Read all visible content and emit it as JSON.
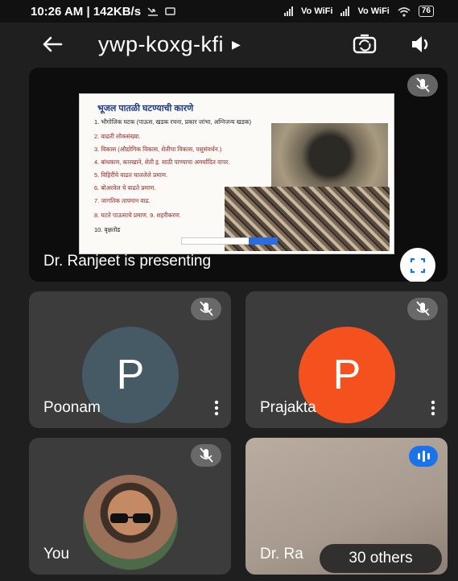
{
  "status_bar": {
    "time_speed": "10:26 AM | 142KB/s",
    "net1": "Vo WiFi",
    "net2": "Vo WiFi",
    "battery": "76"
  },
  "meeting": {
    "code": "ywp-koxg-kfi"
  },
  "presentation": {
    "caption": "Dr. Ranjeet is presenting",
    "slide_title": "भूजल पातळी घटण्याची कारणे",
    "slide_lines": [
      "1. भौगोलिक घटक (पाऊस, खडक रचना, प्रकार जांभा, अग्निजन्य खडक)",
      "2. वाढती लोकसंख्या.",
      "3. विकास (औद्योगिक विकास, शेतीचा विकास, पशुसंवर्धन.)",
      "4. बांधकाम, कारखाने, शेती इ. साठी पाण्याचा अमर्यादित वापर.",
      "5. विहिरींचे वाढत चाललेले प्रमाण.",
      "6. बोअरवेल चे वाढते प्रमाण.",
      "7. जागतिक तापमान वाढ.",
      "8. घटते पाऊसाचे प्रमाण.     9. शहरीकरण.",
      "10. वृक्षतोड"
    ]
  },
  "participants": [
    {
      "name": "Poonam",
      "initial": "P",
      "color": "#455a64"
    },
    {
      "name": "Prajakta",
      "initial": "P",
      "color": "#f4511e"
    },
    {
      "name": "You"
    },
    {
      "name": "Dr. Ra"
    }
  ],
  "others_label": "30 others"
}
